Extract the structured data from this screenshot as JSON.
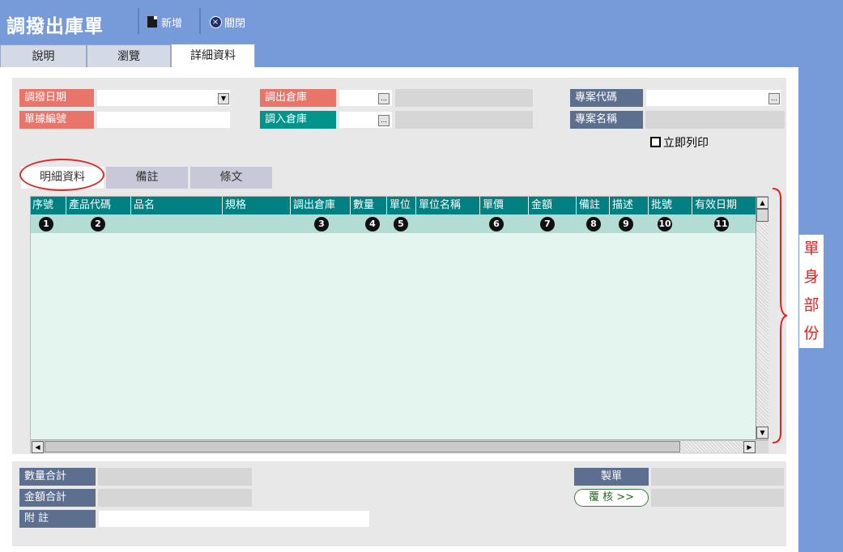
{
  "window": {
    "title": "調撥出庫單"
  },
  "toolbar": {
    "new_label": "新增",
    "close_label": "關閉"
  },
  "page_tabs": [
    {
      "label": "說明"
    },
    {
      "label": "瀏覽"
    },
    {
      "label": "詳細資料",
      "active": true
    }
  ],
  "form": {
    "transfer_date_label": "調撥日期",
    "doc_number_label": "單據編號",
    "out_warehouse_label": "調出倉庫",
    "in_warehouse_label": "調入倉庫",
    "project_code_label": "專案代碼",
    "project_name_label": "專案名稱",
    "print_now_label": "立即列印",
    "transfer_date_value": "",
    "doc_number_value": "",
    "out_warehouse_value": "",
    "in_warehouse_value": "",
    "project_code_value": "",
    "project_name_value": ""
  },
  "sub_tabs": [
    {
      "label": "明細資料",
      "active": true
    },
    {
      "label": "備註"
    },
    {
      "label": "條文"
    }
  ],
  "grid": {
    "columns": [
      "序號",
      "產品代碼",
      "品名",
      "規格",
      "調出倉庫",
      "數量",
      "單位",
      "單位名稱",
      "單價",
      "金額",
      "備註",
      "描述",
      "批號",
      "有效日期"
    ],
    "callouts": [
      "1",
      "2",
      "3",
      "4",
      "5",
      "6",
      "7",
      "8",
      "9",
      "10",
      "11"
    ]
  },
  "annotation": {
    "body_section_label": [
      "單",
      "身",
      "部",
      "份"
    ]
  },
  "footer": {
    "qty_total_label": "數量合計",
    "amount_total_label": "金額合計",
    "note_label": "附 註",
    "maker_label": "製單",
    "review_button_label": "覆 核 >>",
    "qty_total_value": "",
    "amount_total_value": "",
    "note_value": "",
    "maker_value": "",
    "reviewer_value": ""
  },
  "colors": {
    "accent_blue": "#769bd8",
    "label_red": "#e8746a",
    "label_teal": "#00948a",
    "label_slate": "#5d6f8f",
    "grid_header": "#008080",
    "annotation_red": "#e02222"
  }
}
